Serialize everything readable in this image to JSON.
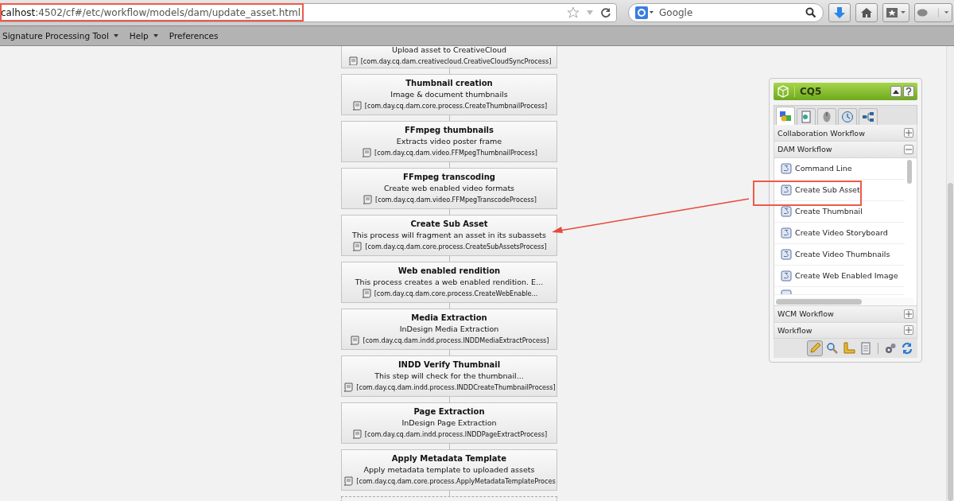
{
  "browser": {
    "url_host": "calhost",
    "url_path": ":4502/cf#/etc/workflow/models/dam/update_asset.html",
    "search_placeholder": "Google"
  },
  "menu": [
    {
      "label": "Signature Processing Tool",
      "dropdown": true
    },
    {
      "label": "Help",
      "dropdown": true
    },
    {
      "label": "Preferences",
      "dropdown": false
    }
  ],
  "steps": [
    {
      "description": "Upload asset to CreativeCloud",
      "process": "[com.day.cq.dam.creativecloud.CreativeCloudSyncProcess]"
    },
    {
      "title": "Thumbnail creation",
      "description": "Image & document thumbnails",
      "process": "[com.day.cq.dam.core.process.CreateThumbnailProcess]"
    },
    {
      "title": "FFmpeg thumbnails",
      "description": "Extracts video poster frame",
      "process": "[com.day.cq.dam.video.FFMpegThumbnailProcess]"
    },
    {
      "title": "FFmpeg transcoding",
      "description": "Create web enabled video formats",
      "process": "[com.day.cq.dam.video.FFMpegTranscodeProcess]"
    },
    {
      "title": "Create Sub Asset",
      "description": "This process will fragment an asset in its subassets",
      "process": "[com.day.cq.dam.core.process.CreateSubAssetsProcess]"
    },
    {
      "title": "Web enabled rendition",
      "description": "This process creates a web enabled rendition. E...",
      "process": "[com.day.cq.dam.core.process.CreateWebEnable..."
    },
    {
      "title": "Media Extraction",
      "description": "InDesign Media Extraction",
      "process": "[com.day.cq.dam.indd.process.INDDMediaExtractProcess]"
    },
    {
      "title": "INDD Verify Thumbnail",
      "description": "This step will check for the thumbnail...",
      "process": "[com.day.cq.dam.indd.process.INDDCreateThumbnailProcess]"
    },
    {
      "title": "Page Extraction",
      "description": "InDesign Page Extraction",
      "process": "[com.day.cq.dam.indd.process.INDDPageExtractProcess]"
    },
    {
      "title": "Apply Metadata Template",
      "description": "Apply metadata template to uploaded assets",
      "process": "[com.day.cq.dam.core.process.ApplyMetadataTemplateProces"
    }
  ],
  "panel": {
    "title": "CQ5",
    "tabs": [
      {
        "kind": "components",
        "selected": true
      },
      {
        "kind": "page",
        "selected": false
      },
      {
        "kind": "mouse",
        "selected": false
      },
      {
        "kind": "clock",
        "selected": false
      },
      {
        "kind": "tree",
        "selected": false
      }
    ],
    "sections": [
      {
        "label": "Collaboration Workflow",
        "expanded": false
      },
      {
        "label": "DAM Workflow",
        "expanded": true,
        "items": [
          "Command Line",
          "Create Sub Asset",
          "Create Thumbnail",
          "Create Video Storyboard",
          "Create Video Thumbnails",
          "Create Web Enabled Image"
        ]
      },
      {
        "label": "WCM Workflow",
        "expanded": false
      },
      {
        "label": "Workflow",
        "expanded": false
      }
    ],
    "tools": [
      {
        "kind": "pencil",
        "selected": true
      },
      {
        "kind": "search",
        "selected": false
      },
      {
        "kind": "ruler",
        "selected": false
      },
      {
        "kind": "document",
        "selected": false
      },
      {
        "kind": "gears",
        "selected": false
      },
      {
        "kind": "refresh",
        "selected": false
      }
    ]
  }
}
